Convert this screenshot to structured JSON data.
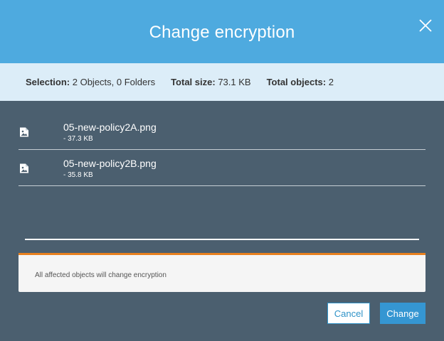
{
  "dialog": {
    "title": "Change encryption",
    "close_icon": "close-icon"
  },
  "summary": {
    "selection_label": "Selection:",
    "selection_value": "2 Objects, 0 Folders",
    "total_size_label": "Total size:",
    "total_size_value": "73.1 KB",
    "total_objects_label": "Total objects:",
    "total_objects_value": "2"
  },
  "files": [
    {
      "name": "05-new-policy2A.png",
      "size": "- 37.3 KB",
      "icon": "image-file-icon"
    },
    {
      "name": "05-new-policy2B.png",
      "size": "- 35.8 KB",
      "icon": "image-file-icon"
    }
  ],
  "notice": {
    "text": "All affected objects will change encryption"
  },
  "buttons": {
    "cancel_label": "Cancel",
    "change_label": "Change"
  },
  "colors": {
    "header": "#4eaadf",
    "summary_bg": "#dcedf8",
    "body_bg": "#4b5f6f",
    "accent_orange": "#e8801e",
    "primary_button": "#3596d2"
  }
}
